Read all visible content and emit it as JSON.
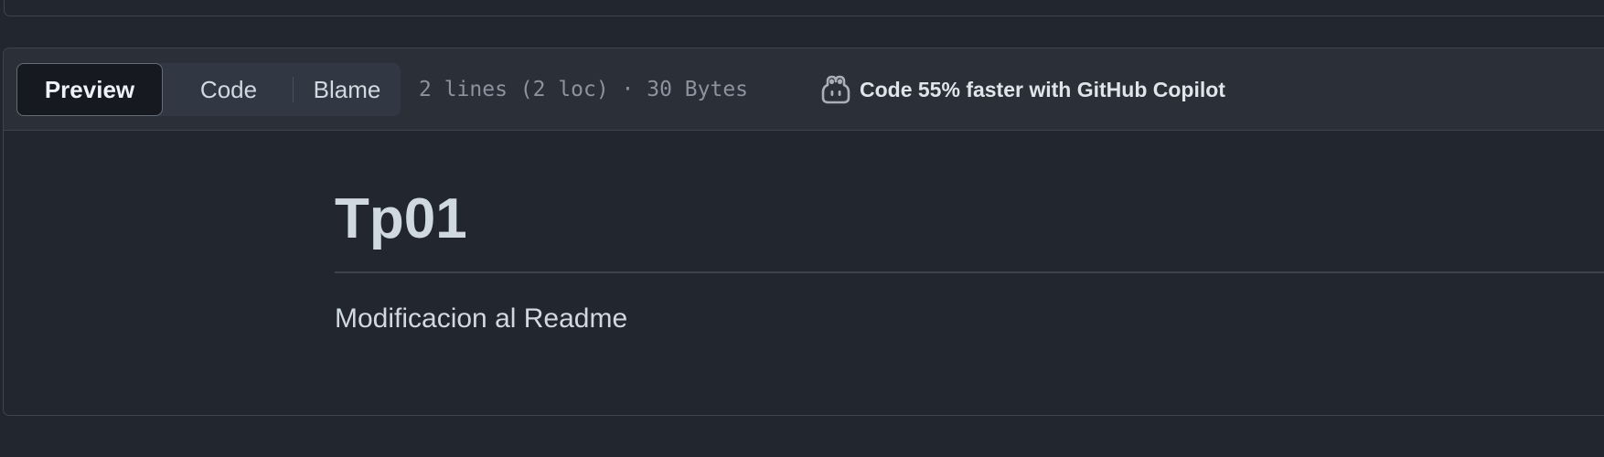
{
  "file_view": {
    "tabs": [
      {
        "label": "Preview",
        "active": true
      },
      {
        "label": "Code",
        "active": false
      },
      {
        "label": "Blame",
        "active": false
      }
    ],
    "meta": "2 lines (2 loc) · 30 Bytes",
    "copilot": {
      "icon": "copilot-icon",
      "label": "Code 55% faster with GitHub Copilot"
    }
  },
  "readme": {
    "title": "Tp01",
    "paragraph": "Modificacion al Readme"
  },
  "colors": {
    "background": "#22262e",
    "header_background": "#2a2f38",
    "border": "#3d444d",
    "active_tab": "#161a20",
    "muted_text": "#8b949e"
  }
}
